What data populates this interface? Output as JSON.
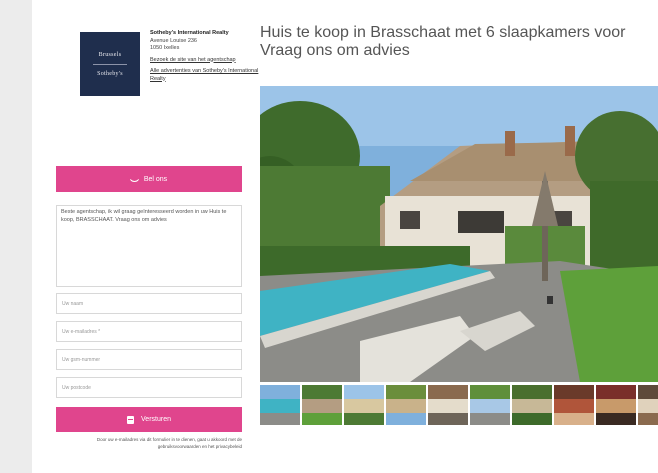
{
  "agent": {
    "logo_line1": "Brussels",
    "logo_line2": "Sotheby's",
    "name": "Sotheby's International Realty",
    "address_line1": "Avenue Louise 236",
    "address_line2": "1050 Ixelles",
    "link_listing": "Bezoek de site van het agentschap",
    "link_all": "Alle advertenties van Sotheby's International Realty"
  },
  "call_button": {
    "label": "Bel ons",
    "icon": "phone-icon"
  },
  "form": {
    "message": "Beste agentschap, ik wil graag geïnteresseerd worden in uw Huis te koop, BRASSCHAAT. Vraag ons om advies",
    "name_placeholder": "Uw naam",
    "email_placeholder": "Uw e-mailadres *",
    "phone_placeholder": "Uw gsm-nummer",
    "zip_placeholder": "Uw postcode",
    "send_label": "Versturen",
    "send_icon": "mail-icon",
    "legal": "Door uw e-mailadres via dit formulier in te dienen, gaat u akkoord met de gebruiksvoorwaarden en het privacybeleid"
  },
  "listing": {
    "title": "Huis te koop in Brasschaat met 6 slaapkamers voor Vraag ons om advies",
    "thumbnail_count": 10
  },
  "colors": {
    "accent": "#e0458d",
    "logo_bg": "#1f2e4d"
  }
}
